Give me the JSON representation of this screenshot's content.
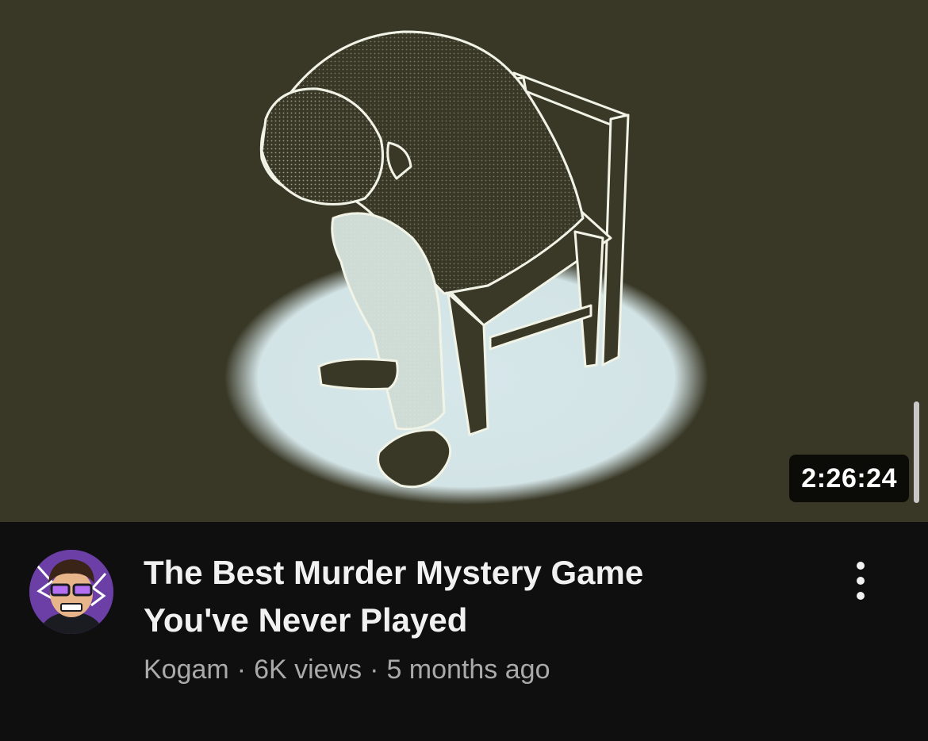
{
  "video": {
    "duration": "2:26:24",
    "title_lines": [
      "The Best Murder Mystery Game",
      "You've Never Played"
    ],
    "channel": "Kogam",
    "views": "6K views",
    "age": "5 months ago",
    "separator": "·"
  },
  "icons": {
    "more": "more-vertical-icon",
    "avatar": "channel-avatar"
  },
  "colors": {
    "thumbnail_background": "#393826",
    "spotlight": "#d5e6e8",
    "page_background": "#0f0f0f",
    "title_text": "#f1f1f1",
    "secondary_text": "#aaaaaa",
    "avatar_background": "#6b3fa6"
  }
}
